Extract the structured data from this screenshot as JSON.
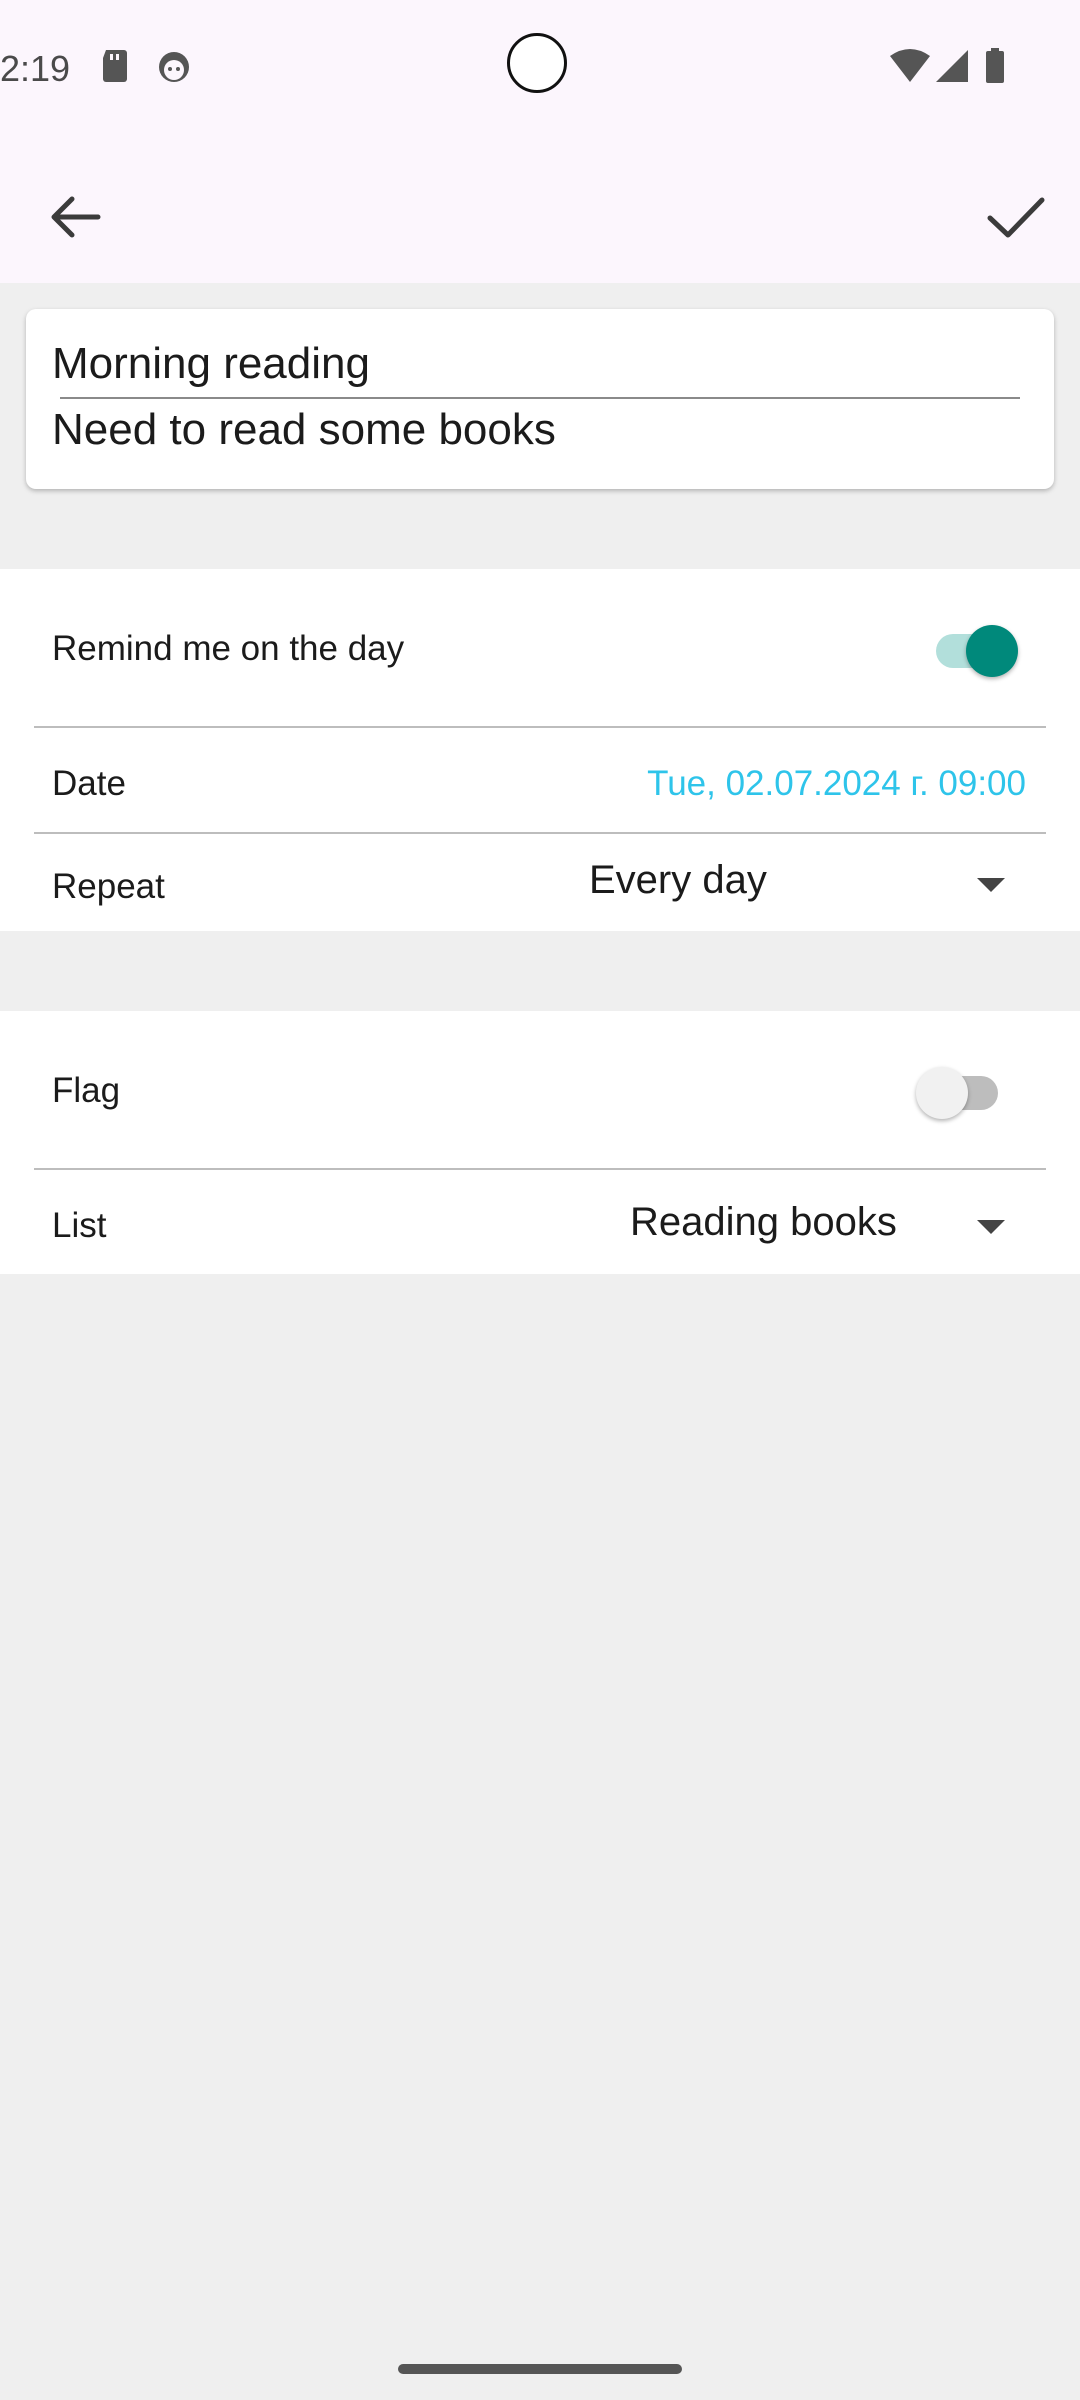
{
  "status_bar": {
    "time": "2:19"
  },
  "app_bar": {
    "back_icon": "arrow-back-icon",
    "confirm_icon": "check-icon"
  },
  "task": {
    "title": "Morning reading",
    "note": "Need to read some books"
  },
  "reminder": {
    "remind_label": "Remind me on the day",
    "remind_on": true,
    "date_label": "Date",
    "date_value": "Tue, 02.07.2024 г. 09:00",
    "repeat_label": "Repeat",
    "repeat_value": "Every day"
  },
  "details": {
    "flag_label": "Flag",
    "flag_on": false,
    "list_label": "List",
    "list_value": "Reading books"
  },
  "colors": {
    "accent": "#00897b",
    "accent_track": "#b2dfdb",
    "date_text": "#2ec4ea",
    "topbar": "#fcf6fd"
  }
}
